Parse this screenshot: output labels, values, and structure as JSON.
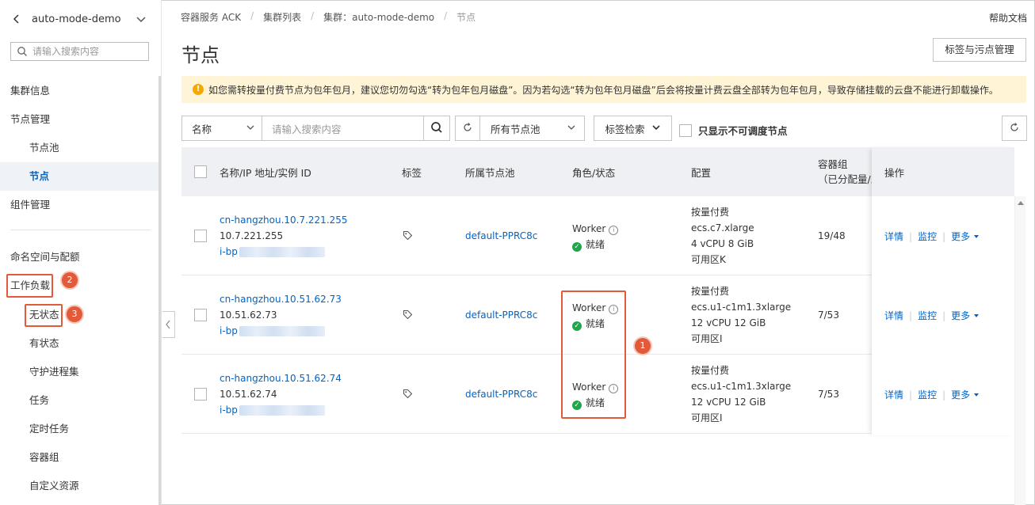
{
  "sidebar": {
    "cluster_name": "auto-mode-demo",
    "search_placeholder": "请输入搜索内容",
    "items": [
      {
        "label": "集群信息"
      },
      {
        "label": "节点管理"
      },
      {
        "label": "节点池"
      },
      {
        "label": "节点"
      },
      {
        "label": "组件管理"
      },
      {
        "label": "命名空间与配额"
      },
      {
        "label": "工作负载"
      },
      {
        "label": "无状态"
      },
      {
        "label": "有状态"
      },
      {
        "label": "守护进程集"
      },
      {
        "label": "任务"
      },
      {
        "label": "定时任务"
      },
      {
        "label": "容器组"
      },
      {
        "label": "自定义资源"
      }
    ]
  },
  "breadcrumb": [
    "容器服务 ACK",
    "集群列表",
    "集群：auto-mode-demo",
    "节点"
  ],
  "help_label": "帮助文档",
  "page_title": "节点",
  "tag_taint_button": "标签与污点管理",
  "alert_text": "如您需转按量付费节点为包年包月，建议您切勿勾选“转为包年包月磁盘”。因为若勾选“转为包年包月磁盘”后会将按量计费云盘全部转为包年包月，导致存储挂载的云盘不能进行卸载操作。",
  "filter": {
    "field": "名称",
    "search_placeholder": "请输入搜索内容",
    "pool_select": "所有节点池",
    "tag_search": "标签检索",
    "unschedulable_label": "只显示不可调度节点"
  },
  "table": {
    "headers": {
      "name": "名称/IP 地址/实例 ID",
      "tags": "标签",
      "pool": "所属节点池",
      "role": "角色/状态",
      "config": "配置",
      "pods_1": "容器组",
      "pods_2": "（已分配量/总",
      "ops": "操作"
    },
    "rows": [
      {
        "name": "cn-hangzhou.10.7.221.255",
        "ip": "10.7.221.255",
        "instance_prefix": "i-bp",
        "pool": "default-PPRC8c",
        "role": "Worker",
        "status": "就绪",
        "billing": "按量付费",
        "type": "ecs.c7.xlarge",
        "spec": "4 vCPU 8 GiB",
        "zone": "可用区K",
        "pods": "19/48"
      },
      {
        "name": "cn-hangzhou.10.51.62.73",
        "ip": "10.51.62.73",
        "instance_prefix": "i-bp",
        "pool": "default-PPRC8c",
        "role": "Worker",
        "status": "就绪",
        "billing": "按量付费",
        "type": "ecs.u1-c1m1.3xlarge",
        "spec": "12 vCPU 12 GiB",
        "zone": "可用区I",
        "pods": "7/53"
      },
      {
        "name": "cn-hangzhou.10.51.62.74",
        "ip": "10.51.62.74",
        "instance_prefix": "i-bp",
        "pool": "default-PPRC8c",
        "role": "Worker",
        "status": "就绪",
        "billing": "按量付费",
        "type": "ecs.u1-c1m1.3xlarge",
        "spec": "12 vCPU 12 GiB",
        "zone": "可用区I",
        "pods": "7/53"
      }
    ],
    "ops": {
      "detail": "详情",
      "monitor": "监控",
      "more": "更多"
    }
  },
  "annotations": {
    "b1": "1",
    "b2": "2",
    "b3": "3"
  },
  "colors": {
    "accent": "#0064c8",
    "highlight": "#e25a3a",
    "ok": "#1fa64b",
    "alert_bg": "#fff4d6"
  }
}
